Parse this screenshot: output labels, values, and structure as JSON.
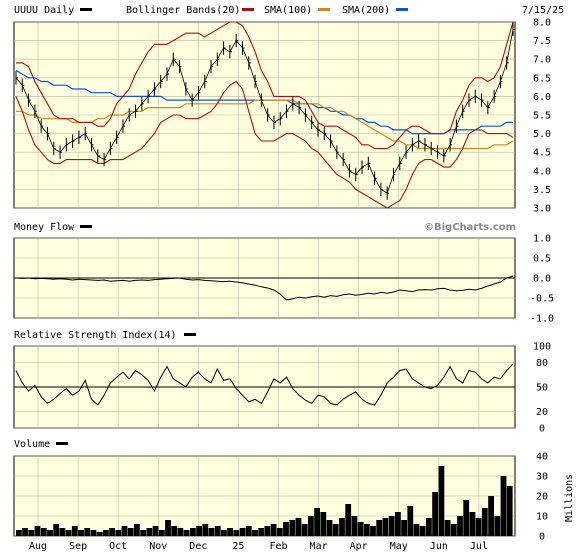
{
  "chart_data": {
    "type": "stock-chart",
    "date": "7/15/25",
    "watermark": "©BigCharts.com",
    "months": [
      "Aug",
      "Sep",
      "Oct",
      "Nov",
      "Dec",
      "25",
      "Feb",
      "Mar",
      "Apr",
      "May",
      "Jun",
      "Jul"
    ],
    "colors": {
      "plot_bg": "#ffffe0",
      "grid": "#b8b8a0",
      "price": "#000000",
      "bollinger": "#aa1111",
      "sma100": "#cc8822",
      "sma200": "#1155cc",
      "volume": "#000000"
    },
    "price_panel": {
      "legend": [
        {
          "label": "UUUU Daily",
          "color": "#000000"
        },
        {
          "label": "Bollinger Bands(20)",
          "color": "#aa1111"
        },
        {
          "label": "SMA(100)",
          "color": "#cc8822"
        },
        {
          "label": "SMA(200)",
          "color": "#1155cc"
        }
      ],
      "yticks": [
        "8.0",
        "7.5",
        "7.0",
        "6.5",
        "6.0",
        "5.5",
        "5.0",
        "4.5",
        "4.0",
        "3.5",
        "3.0"
      ],
      "ylim": [
        3.0,
        8.0
      ],
      "close": [
        6.5,
        6.3,
        5.9,
        5.6,
        5.2,
        5.0,
        4.6,
        4.5,
        4.7,
        4.8,
        4.9,
        5.0,
        4.7,
        4.4,
        4.3,
        4.6,
        4.9,
        5.2,
        5.5,
        5.6,
        5.8,
        6.0,
        6.2,
        6.4,
        6.6,
        7.0,
        6.8,
        6.2,
        5.9,
        6.1,
        6.4,
        6.8,
        7.0,
        7.3,
        7.2,
        7.5,
        7.3,
        6.9,
        6.4,
        5.9,
        5.5,
        5.3,
        5.4,
        5.6,
        5.8,
        5.7,
        5.5,
        5.3,
        5.1,
        5.0,
        4.8,
        4.5,
        4.3,
        4.0,
        3.9,
        4.1,
        4.2,
        3.8,
        3.5,
        3.4,
        3.9,
        4.2,
        4.5,
        4.7,
        4.8,
        4.7,
        4.6,
        4.5,
        4.4,
        4.7,
        5.2,
        5.6,
        5.9,
        6.0,
        5.9,
        5.7,
        6.0,
        6.4,
        6.9,
        7.8
      ],
      "bb_upper": [
        6.9,
        6.9,
        6.8,
        6.4,
        6.1,
        5.8,
        5.5,
        5.4,
        5.4,
        5.4,
        5.3,
        5.3,
        5.3,
        5.2,
        5.2,
        5.4,
        5.8,
        6.0,
        6.2,
        6.6,
        6.9,
        7.2,
        7.4,
        7.4,
        7.4,
        7.5,
        7.6,
        7.7,
        7.7,
        7.7,
        7.6,
        7.7,
        7.8,
        7.9,
        8.0,
        8.0,
        7.9,
        7.6,
        7.2,
        6.7,
        6.4,
        6.0,
        6.0,
        6.0,
        6.0,
        6.0,
        5.9,
        5.6,
        5.3,
        5.2,
        5.2,
        5.2,
        5.1,
        5.0,
        4.9,
        4.7,
        4.7,
        4.6,
        4.6,
        4.6,
        4.7,
        4.9,
        5.1,
        5.2,
        5.2,
        5.1,
        5.0,
        5.0,
        5.0,
        5.1,
        5.6,
        5.9,
        6.3,
        6.5,
        6.5,
        6.4,
        6.5,
        6.8,
        7.4,
        8.0
      ],
      "bb_lower": [
        6.0,
        5.6,
        5.1,
        4.7,
        4.5,
        4.3,
        4.2,
        4.2,
        4.3,
        4.3,
        4.3,
        4.3,
        4.3,
        4.2,
        4.2,
        4.3,
        4.3,
        4.3,
        4.4,
        4.5,
        4.6,
        4.8,
        5.0,
        5.3,
        5.4,
        5.5,
        5.5,
        5.4,
        5.4,
        5.4,
        5.5,
        5.6,
        5.8,
        6.1,
        6.3,
        6.4,
        6.2,
        5.6,
        5.0,
        4.8,
        4.8,
        4.8,
        4.9,
        5.0,
        5.0,
        4.9,
        4.8,
        4.6,
        4.5,
        4.3,
        4.1,
        3.9,
        3.8,
        3.7,
        3.5,
        3.4,
        3.3,
        3.2,
        3.1,
        3.0,
        3.1,
        3.2,
        3.5,
        3.9,
        4.2,
        4.3,
        4.3,
        4.2,
        4.1,
        4.1,
        4.3,
        4.6,
        5.0,
        5.1,
        5.1,
        5.0,
        5.0,
        5.0,
        5.0,
        4.9
      ],
      "sma100": [
        5.6,
        5.6,
        5.5,
        5.5,
        5.4,
        5.4,
        5.4,
        5.4,
        5.4,
        5.3,
        5.3,
        5.3,
        5.3,
        5.4,
        5.4,
        5.5,
        5.5,
        5.5,
        5.6,
        5.6,
        5.6,
        5.7,
        5.7,
        5.7,
        5.7,
        5.7,
        5.7,
        5.8,
        5.8,
        5.8,
        5.8,
        5.8,
        5.8,
        5.8,
        5.8,
        5.8,
        5.8,
        5.8,
        5.9,
        5.9,
        5.9,
        5.9,
        5.9,
        5.9,
        5.9,
        5.8,
        5.8,
        5.8,
        5.8,
        5.7,
        5.7,
        5.6,
        5.6,
        5.5,
        5.4,
        5.3,
        5.2,
        5.1,
        5.0,
        4.9,
        4.8,
        4.8,
        4.7,
        4.7,
        4.6,
        4.6,
        4.6,
        4.6,
        4.6,
        4.6,
        4.6,
        4.6,
        4.6,
        4.6,
        4.6,
        4.6,
        4.7,
        4.7,
        4.7,
        4.8
      ],
      "sma200": [
        6.7,
        6.6,
        6.5,
        6.5,
        6.4,
        6.4,
        6.3,
        6.3,
        6.3,
        6.2,
        6.2,
        6.2,
        6.1,
        6.1,
        6.1,
        6.1,
        6.0,
        6.0,
        6.0,
        6.0,
        6.0,
        6.0,
        6.0,
        6.0,
        5.9,
        5.9,
        5.9,
        5.9,
        5.9,
        5.9,
        5.9,
        5.9,
        5.9,
        5.9,
        5.9,
        5.9,
        5.9,
        5.9,
        5.9,
        5.9,
        5.9,
        5.9,
        5.9,
        5.9,
        5.8,
        5.8,
        5.8,
        5.8,
        5.7,
        5.7,
        5.6,
        5.6,
        5.5,
        5.5,
        5.4,
        5.4,
        5.3,
        5.3,
        5.2,
        5.2,
        5.1,
        5.1,
        5.1,
        5.0,
        5.0,
        5.0,
        5.0,
        5.0,
        5.0,
        5.1,
        5.1,
        5.1,
        5.1,
        5.1,
        5.2,
        5.2,
        5.2,
        5.2,
        5.3,
        5.3
      ]
    },
    "money_flow_panel": {
      "label": "Money Flow",
      "yticks": [
        "1.0",
        "0.5",
        "0.0",
        "-0.5",
        "-1.0"
      ],
      "ylim": [
        -1.0,
        1.0
      ],
      "reference": 0.0,
      "values": [
        0.0,
        -0.01,
        0.0,
        -0.02,
        -0.01,
        -0.02,
        -0.03,
        -0.02,
        -0.03,
        -0.05,
        -0.03,
        -0.04,
        -0.05,
        -0.06,
        -0.05,
        -0.08,
        -0.07,
        -0.06,
        -0.08,
        -0.06,
        -0.05,
        -0.06,
        -0.04,
        -0.03,
        -0.02,
        -0.01,
        0.0,
        -0.03,
        -0.05,
        -0.04,
        -0.06,
        -0.07,
        -0.08,
        -0.09,
        -0.08,
        -0.1,
        -0.12,
        -0.15,
        -0.18,
        -0.22,
        -0.25,
        -0.3,
        -0.4,
        -0.55,
        -0.52,
        -0.48,
        -0.5,
        -0.47,
        -0.45,
        -0.48,
        -0.44,
        -0.46,
        -0.42,
        -0.4,
        -0.43,
        -0.41,
        -0.38,
        -0.4,
        -0.36,
        -0.38,
        -0.35,
        -0.3,
        -0.32,
        -0.34,
        -0.3,
        -0.29,
        -0.3,
        -0.27,
        -0.26,
        -0.3,
        -0.32,
        -0.31,
        -0.28,
        -0.3,
        -0.26,
        -0.2,
        -0.15,
        -0.1,
        0.0,
        0.05
      ]
    },
    "rsi_panel": {
      "label": "Relative Strength Index(14)",
      "yticks": [
        "100",
        "80",
        "50",
        "20",
        "0"
      ],
      "ylim": [
        0,
        100
      ],
      "reference": 50,
      "values": [
        70,
        55,
        45,
        52,
        38,
        30,
        35,
        42,
        48,
        40,
        45,
        58,
        35,
        28,
        40,
        55,
        62,
        68,
        60,
        70,
        65,
        58,
        45,
        62,
        75,
        60,
        55,
        50,
        62,
        68,
        60,
        55,
        72,
        58,
        60,
        48,
        40,
        32,
        35,
        30,
        44,
        60,
        55,
        62,
        48,
        40,
        34,
        30,
        40,
        38,
        30,
        28,
        35,
        40,
        44,
        35,
        30,
        28,
        40,
        55,
        62,
        70,
        72,
        60,
        55,
        50,
        48,
        52,
        62,
        75,
        60,
        55,
        70,
        68,
        60,
        55,
        62,
        60,
        70,
        78
      ]
    },
    "volume_panel": {
      "label": "Volume",
      "yticks": [
        "40",
        "30",
        "20",
        "10",
        "0"
      ],
      "ylim": [
        0,
        40
      ],
      "unit_label": "Millions",
      "values": [
        3,
        4,
        3,
        5,
        4,
        3,
        6,
        4,
        3,
        5,
        3,
        4,
        3,
        2,
        3,
        4,
        3,
        5,
        4,
        6,
        3,
        4,
        5,
        3,
        8,
        5,
        4,
        3,
        4,
        5,
        6,
        4,
        5,
        3,
        4,
        3,
        4,
        5,
        3,
        4,
        5,
        6,
        4,
        7,
        8,
        9,
        6,
        10,
        14,
        12,
        8,
        6,
        9,
        16,
        10,
        7,
        6,
        5,
        8,
        9,
        10,
        12,
        8,
        15,
        6,
        5,
        9,
        22,
        35,
        8,
        6,
        10,
        18,
        12,
        9,
        14,
        20,
        10,
        30,
        25
      ]
    }
  }
}
